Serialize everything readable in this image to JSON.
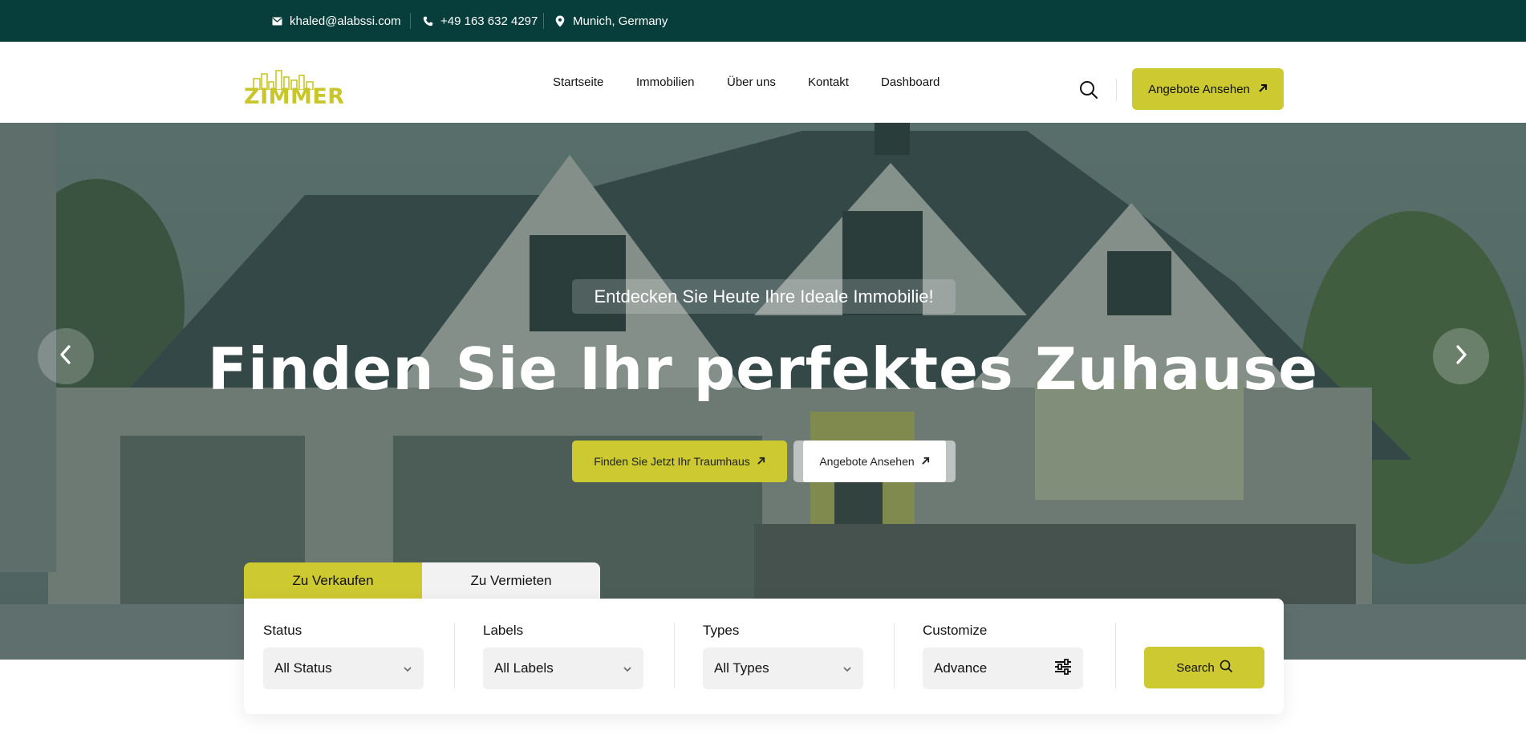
{
  "topbar": {
    "email": "khaled@alabssi.com",
    "phone": "+49 163 632 4297",
    "location": "Munich, Germany",
    "icons": [
      "mail-icon",
      "phone-icon",
      "location-pin-icon"
    ]
  },
  "header": {
    "logo_text": "ZIMMER",
    "nav": [
      {
        "label": "Startseite"
      },
      {
        "label": "Immobilien"
      },
      {
        "label": "Über uns"
      },
      {
        "label": "Kontakt"
      },
      {
        "label": "Dashboard"
      }
    ],
    "cta_label": "Angebote Ansehen",
    "cta_icon": "arrow-up-right-icon",
    "search_icon": "search-icon"
  },
  "hero": {
    "eyebrow": "Entdecken Sie Heute Ihre Ideale Immobilie!",
    "title": "Finden Sie Ihr perfektes Zuhause",
    "primary_button": "Finden Sie Jetzt Ihr Traumhaus",
    "secondary_button": "Angebote Ansehen",
    "prev_icon": "chevron-left-icon",
    "next_icon": "chevron-right-icon"
  },
  "search": {
    "tabs": [
      {
        "label": "Zu Verkaufen",
        "active": true
      },
      {
        "label": "Zu Vermieten",
        "active": false
      }
    ],
    "fields": [
      {
        "label": "Status",
        "value": "All Status"
      },
      {
        "label": "Labels",
        "value": "All Labels"
      },
      {
        "label": "Types",
        "value": "All Types"
      },
      {
        "label": "Customize",
        "value": "Advance"
      }
    ],
    "button_label": "Search"
  },
  "colors": {
    "topbar": "#073d3a",
    "accent": "#cdc931",
    "text": "#111111"
  }
}
